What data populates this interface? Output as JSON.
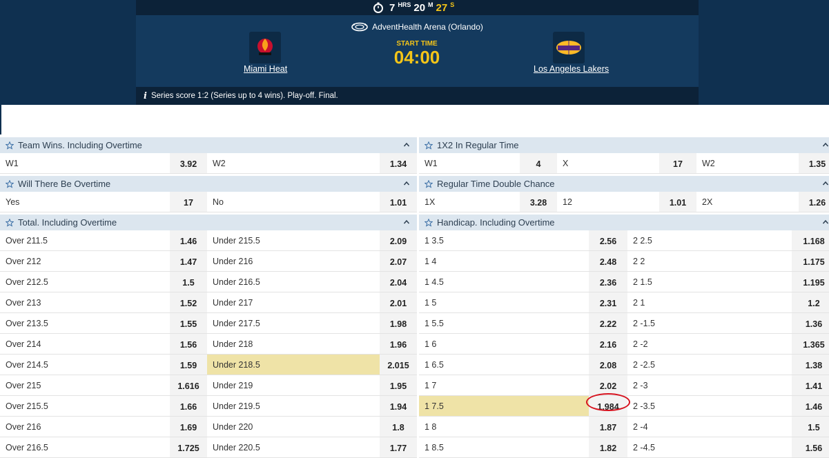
{
  "header": {
    "countdown": {
      "hours": "7",
      "hours_unit": "HRS",
      "minutes": "20",
      "minutes_unit": "M",
      "seconds": "27",
      "seconds_unit": "S"
    },
    "venue": "AdventHealth Arena (Orlando)",
    "home_team": "Miami Heat",
    "away_team": "Los Angeles Lakers",
    "start_label": "START TIME",
    "start_time": "04:00",
    "series_info": "Series score 1:2 (Series up to 4 wins). Play-off. Final."
  },
  "colors": {
    "header_bg": "#0f3050",
    "accent_gold": "#f5c518",
    "market_header_bg": "#dce6ef",
    "highlight": "#efe3a7",
    "circle_annotation": "#d6121e"
  },
  "markets": {
    "team_wins": {
      "title": "Team Wins. Including Overtime",
      "rows": [
        [
          "W1",
          "3.92",
          "W2",
          "1.34"
        ]
      ]
    },
    "overtime": {
      "title": "Will There Be Overtime",
      "rows": [
        [
          "Yes",
          "17",
          "No",
          "1.01"
        ]
      ]
    },
    "total": {
      "title": "Total. Including Overtime",
      "rows": [
        [
          "Over 211.5",
          "1.46",
          "Under 215.5",
          "2.09"
        ],
        [
          "Over 212",
          "1.47",
          "Under 216",
          "2.07"
        ],
        [
          "Over 212.5",
          "1.5",
          "Under 216.5",
          "2.04"
        ],
        [
          "Over 213",
          "1.52",
          "Under 217",
          "2.01"
        ],
        [
          "Over 213.5",
          "1.55",
          "Under 217.5",
          "1.98"
        ],
        [
          "Over 214",
          "1.56",
          "Under 218",
          "1.96"
        ],
        [
          "Over 214.5",
          "1.59",
          "Under 218.5",
          "2.015"
        ],
        [
          "Over 215",
          "1.616",
          "Under 219",
          "1.95"
        ],
        [
          "Over 215.5",
          "1.66",
          "Under 219.5",
          "1.94"
        ],
        [
          "Over 216",
          "1.69",
          "Under 220",
          "1.8"
        ],
        [
          "Over 216.5",
          "1.725",
          "Under 220.5",
          "1.77"
        ]
      ]
    },
    "one_x_two": {
      "title": "1X2 In Regular Time",
      "rows": [
        [
          "W1",
          "4",
          "X",
          "17",
          "W2",
          "1.35"
        ]
      ]
    },
    "double_chance": {
      "title": "Regular Time Double Chance",
      "rows": [
        [
          "1X",
          "3.28",
          "12",
          "1.01",
          "2X",
          "1.26"
        ]
      ]
    },
    "handicap": {
      "title": "Handicap. Including Overtime",
      "rows": [
        [
          "1 3.5",
          "2.56",
          "2 2.5",
          "1.168"
        ],
        [
          "1 4",
          "2.48",
          "2 2",
          "1.175"
        ],
        [
          "1 4.5",
          "2.36",
          "2 1.5",
          "1.195"
        ],
        [
          "1 5",
          "2.31",
          "2 1",
          "1.2"
        ],
        [
          "1 5.5",
          "2.22",
          "2 -1.5",
          "1.36"
        ],
        [
          "1 6",
          "2.16",
          "2 -2",
          "1.365"
        ],
        [
          "1 6.5",
          "2.08",
          "2 -2.5",
          "1.38"
        ],
        [
          "1 7",
          "2.02",
          "2 -3",
          "1.41"
        ],
        [
          "1 7.5",
          "1.984",
          "2 -3.5",
          "1.46"
        ],
        [
          "1 8",
          "1.87",
          "2 -4",
          "1.5"
        ],
        [
          "1 8.5",
          "1.82",
          "2 -4.5",
          "1.56"
        ]
      ]
    }
  }
}
